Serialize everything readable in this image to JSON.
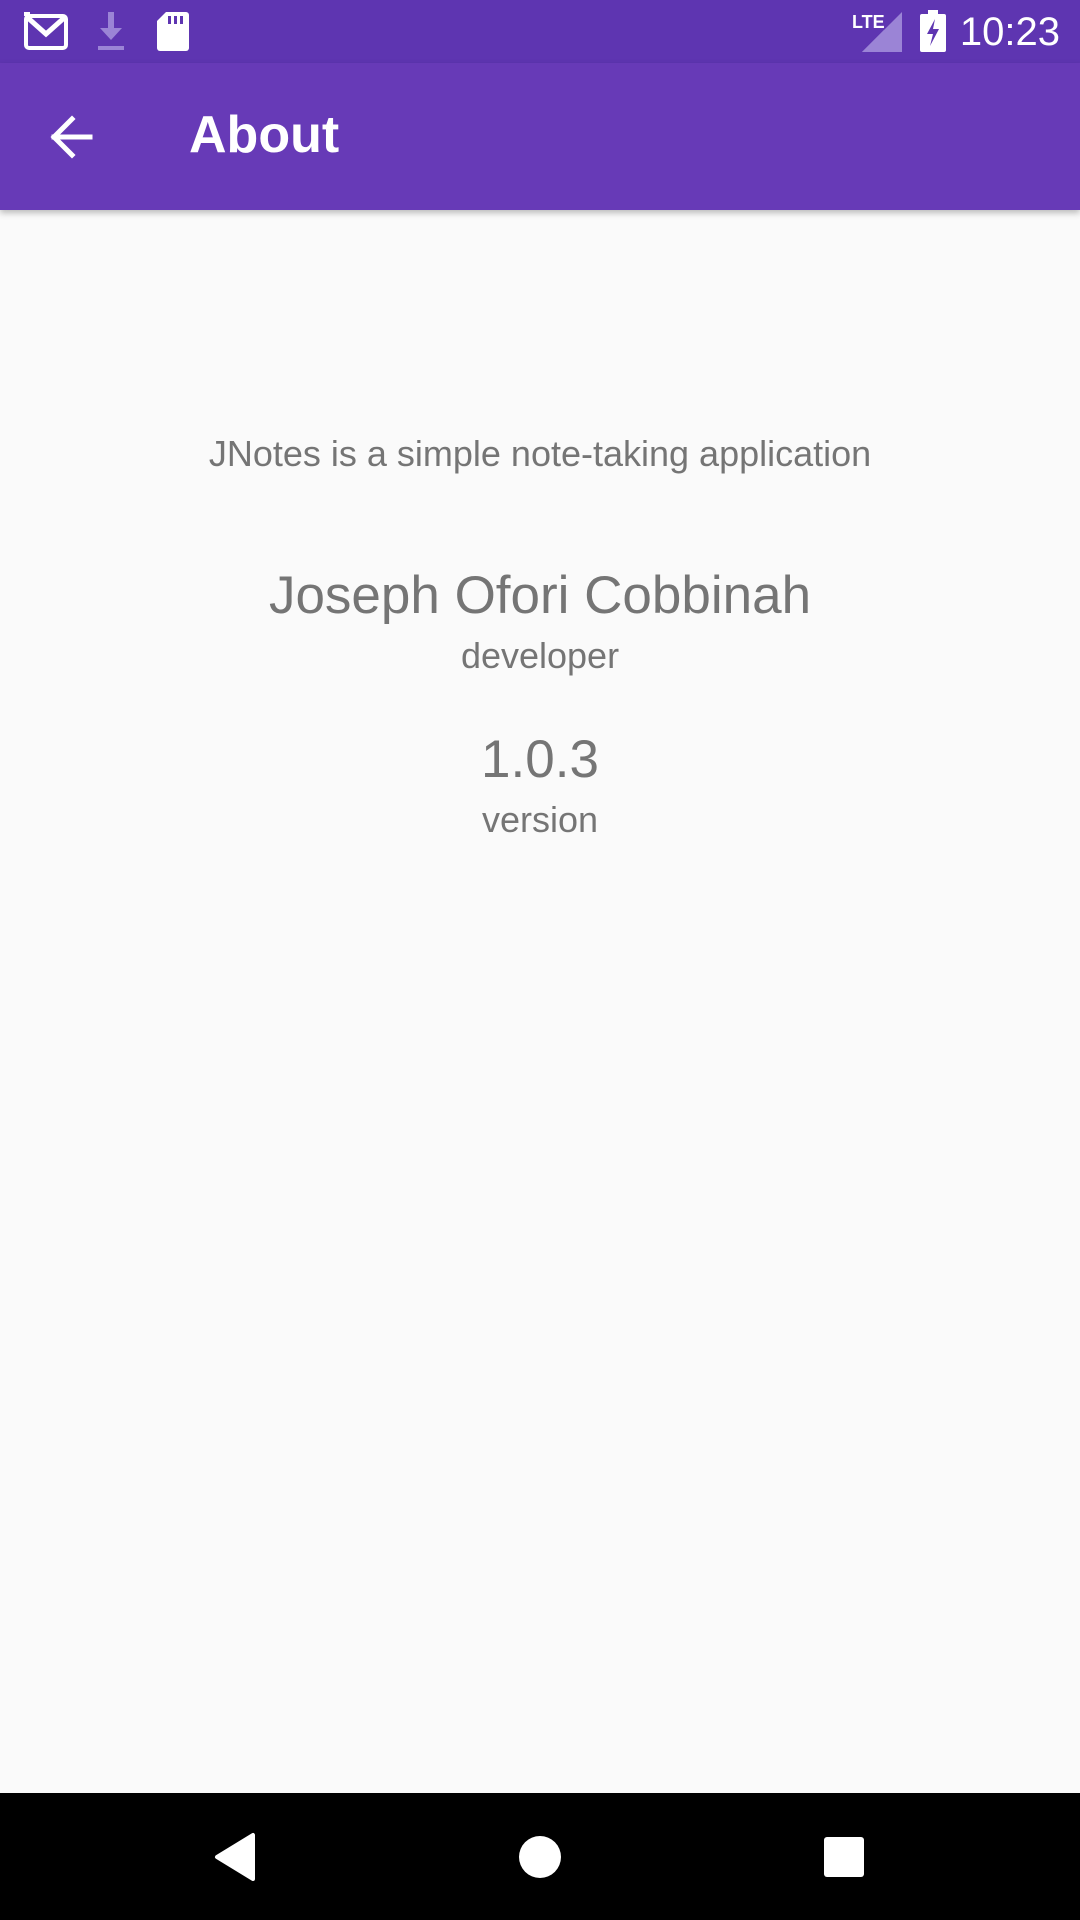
{
  "status_bar": {
    "time": "10:23",
    "network": "LTE",
    "icons": [
      "gmail-icon",
      "download-icon",
      "sd-card-icon",
      "signal-icon",
      "battery-charging-icon"
    ],
    "background_color": "#5e35b1"
  },
  "app_bar": {
    "title": "About",
    "back_icon": "arrow-back-icon",
    "background_color": "#673ab7"
  },
  "about": {
    "description": "JNotes is a simple note-taking application",
    "developer_name": "Joseph Ofori Cobbinah",
    "developer_label": "developer",
    "version_number": "1.0.3",
    "version_label": "version",
    "text_color": "#757575"
  },
  "nav_bar": {
    "buttons": [
      "back-triangle-icon",
      "home-circle-icon",
      "recents-square-icon"
    ]
  }
}
